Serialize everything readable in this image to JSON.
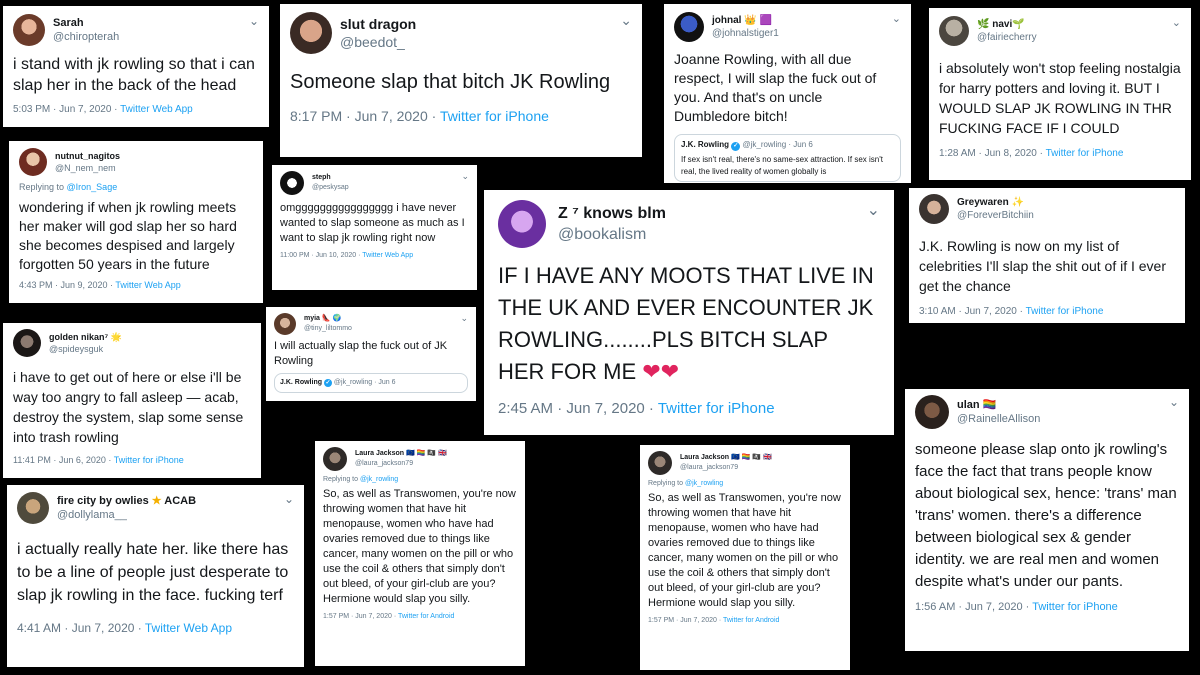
{
  "icons": {
    "chevron": "⌄",
    "verified": "✓",
    "heart": "❤",
    "star": "★"
  },
  "tweets": {
    "sarah": {
      "name": "Sarah",
      "handle": "@chiropterah",
      "text": "i stand with jk rowling so that i can slap her in the back of the head",
      "time": "5:03 PM · Jun 7, 2020 · ",
      "source": "Twitter Web App"
    },
    "slut": {
      "name": "slut dragon",
      "handle": "@beedot_",
      "text": "Someone slap that bitch JK Rowling",
      "time": "8:17 PM · Jun 7, 2020 · ",
      "source": "Twitter for iPhone"
    },
    "johnal": {
      "name": "johnal",
      "badge": "👑 🟪",
      "handle": "@johnalstiger1",
      "text": "Joanne Rowling, with all due respect, I will slap the fuck out of you. And that's on uncle Dumbledore bitch!",
      "quote_name": "J.K. Rowling",
      "quote_meta": "@jk_rowling · Jun 6",
      "quote_text": "If sex isn't real, there's no same-sex attraction. If sex isn't real, the lived reality of women globally is"
    },
    "navi": {
      "name": "navi",
      "badge_pre": "🌿",
      "badge_post": "🌱",
      "handle": "@fairiecherry",
      "text": "i absolutely won't stop feeling nostalgia for harry potters and loving it. BUT I WOULD SLAP JK ROWLING IN THR FUCKING FACE IF I COULD",
      "time": "1:28 AM · Jun 8, 2020 · ",
      "source": "Twitter for iPhone"
    },
    "nutnut": {
      "name": "nutnut_nagitos",
      "handle": "@N_nem_nem",
      "reply_label": "Replying to ",
      "reply_handle": "@Iron_Sage",
      "text": "wondering if when jk rowling meets her maker will god slap her so hard she becomes despised and largely forgotten 50 years in the future",
      "time": "4:43 PM · Jun 9, 2020 · ",
      "source": "Twitter Web App"
    },
    "steph": {
      "name": "steph",
      "handle": "@peskysap",
      "text": "omgggggggggggggggg i have never wanted to slap someone as much as I want to slap jk rowling right now",
      "time": "11:00 PM · Jun 10, 2020 · ",
      "source": "Twitter Web App"
    },
    "z7": {
      "name": "Z ⁷ knows blm",
      "handle": "@bookalism",
      "text": "IF I HAVE ANY MOOTS THAT LIVE IN THE UK AND EVER ENCOUNTER JK ROWLING........PLS BITCH SLAP HER FOR ME ",
      "hearts": "❤❤",
      "time": "2:45 AM · Jun 7, 2020 · ",
      "source": "Twitter for iPhone"
    },
    "grey": {
      "name": "Greywaren",
      "badge": "✨",
      "handle": "@ForeverBitchiin",
      "text": "J.K. Rowling is now on my list of celebrities I'll slap the shit out of if I ever get the chance",
      "time": "3:10 AM · Jun 7, 2020 · ",
      "source": "Twitter for iPhone"
    },
    "golden": {
      "name": "golden nikan⁷",
      "badge": "🌟",
      "handle": "@spideysguk",
      "text": "i have to get out of here or else i'll be way too angry to fall asleep — acab, destroy the system, slap some sense into trash rowling",
      "time": "11:41 PM · Jun 6, 2020 · ",
      "source": "Twitter for iPhone"
    },
    "myia": {
      "name": "myia",
      "badge": "👠 🌍",
      "handle": "@tiny_liltommo",
      "text": "I will actually slap the fuck out of JK Rowling",
      "quote_name": "J.K. Rowling",
      "quote_meta": "@jk_rowling · Jun 6"
    },
    "fire": {
      "name": "fire city by owlies",
      "badge": "ACAB",
      "handle": "@dollylama__",
      "text": "i actually really hate her. like there has to be a line of people just desperate to slap jk rowling in the face. fucking terf",
      "time": "4:41 AM · Jun 7, 2020 · ",
      "source": "Twitter Web App"
    },
    "laura1": {
      "name": "Laura Jackson",
      "badge": "🇪🇺 🏳️‍🌈 🏴‍☠️ 🇬🇧",
      "handle": "@laura_jackson79",
      "reply_label": "Replying to ",
      "reply_handle": "@jk_rowling",
      "text": "So, as well as Transwomen, you're now throwing women that have hit menopause, women who have had ovaries removed due to things like cancer, many women on the pill or who use the coil & others that simply don't out bleed, of your girl-club are you? Hermione would slap you silly.",
      "time": "1:57 PM · Jun 7, 2020 · ",
      "source": "Twitter for Android"
    },
    "laura2": {
      "name": "Laura Jackson",
      "badge": "🇪🇺 🏳️‍🌈 🏴‍☠️ 🇬🇧",
      "handle": "@laura_jackson79",
      "reply_label": "Replying to ",
      "reply_handle": "@jk_rowling",
      "text": "So, as well as Transwomen, you're now throwing women that have hit menopause, women who have had ovaries removed due to things like cancer, many women on the pill or who use the coil & others that simply don't out bleed, of your girl-club are you? Hermione would slap you silly.",
      "time": "1:57 PM · Jun 7, 2020 · ",
      "source": "Twitter for Android"
    },
    "ulan": {
      "name": "ulan",
      "badge": "🏳️‍🌈",
      "handle": "@RainelleAllison",
      "text": "someone please slap onto jk rowling's face the fact that trans people know about biological sex, hence: 'trans' man 'trans' women. there's a difference between biological sex & gender identity. we are real men and women despite what's under our pants.",
      "time": "1:56 AM · Jun 7, 2020 · ",
      "source": "Twitter for iPhone"
    }
  },
  "colors": {
    "link": "#1da1f2",
    "meta": "#657786",
    "text": "#14171a",
    "background": "#000000"
  }
}
